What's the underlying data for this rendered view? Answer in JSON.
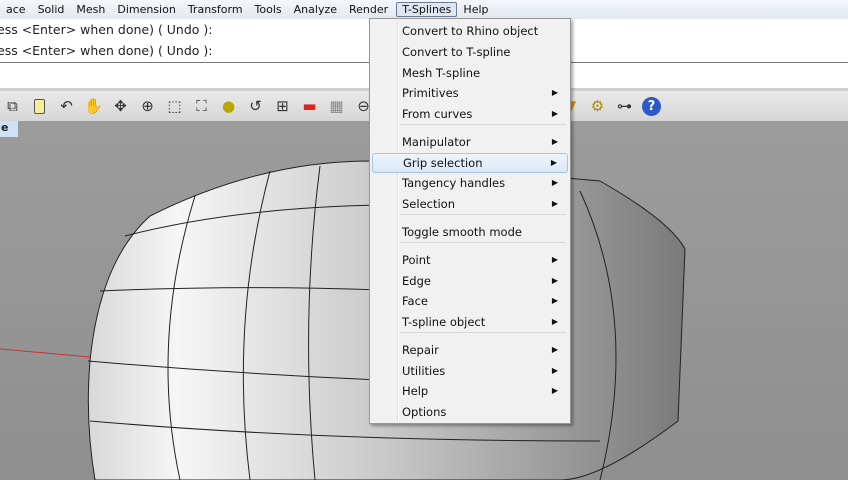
{
  "menubar": {
    "items": [
      "ace",
      "Solid",
      "Mesh",
      "Dimension",
      "Transform",
      "Tools",
      "Analyze",
      "Render",
      "T-Splines",
      "Help"
    ]
  },
  "command": {
    "lines": [
      "ess <Enter> when done) ( Undo ):",
      "ess <Enter> when done) ( Undo ):"
    ]
  },
  "viewport": {
    "tab": "e"
  },
  "toolbar": {
    "icons": [
      "copy-icon",
      "paste-icon",
      "undo-icon",
      "pan-hand-icon",
      "rotate-view-icon",
      "zoom-in-icon",
      "zoom-window-icon",
      "zoom-extents-icon",
      "zoom-selected-icon",
      "undo-view-icon",
      "four-viewports-icon",
      "car-render-icon",
      "grid-icon",
      "osnap-icon",
      "cone-icon",
      "gear-icon",
      "tree-icon",
      "help-icon"
    ]
  },
  "tsplines_menu": {
    "items": [
      {
        "label": "Convert to Rhino object",
        "sub": false
      },
      {
        "label": "Convert to T-spline",
        "sub": false
      },
      {
        "label": "Mesh T-spline",
        "sub": false
      },
      {
        "label": "Primitives",
        "sub": true
      },
      {
        "label": "From curves",
        "sub": true
      },
      {
        "label": "Manipulator",
        "sub": true
      },
      {
        "label": "Grip selection",
        "sub": true,
        "highlighted": true
      },
      {
        "label": "Tangency handles",
        "sub": true
      },
      {
        "label": "Selection",
        "sub": true
      },
      {
        "label": "Toggle smooth mode",
        "sub": false
      },
      {
        "label": "Point",
        "sub": true
      },
      {
        "label": "Edge",
        "sub": true
      },
      {
        "label": "Face",
        "sub": true
      },
      {
        "label": "T-spline object",
        "sub": true
      },
      {
        "label": "Repair",
        "sub": true
      },
      {
        "label": "Utilities",
        "sub": true
      },
      {
        "label": "Help",
        "sub": true
      },
      {
        "label": "Options",
        "sub": false
      }
    ]
  }
}
